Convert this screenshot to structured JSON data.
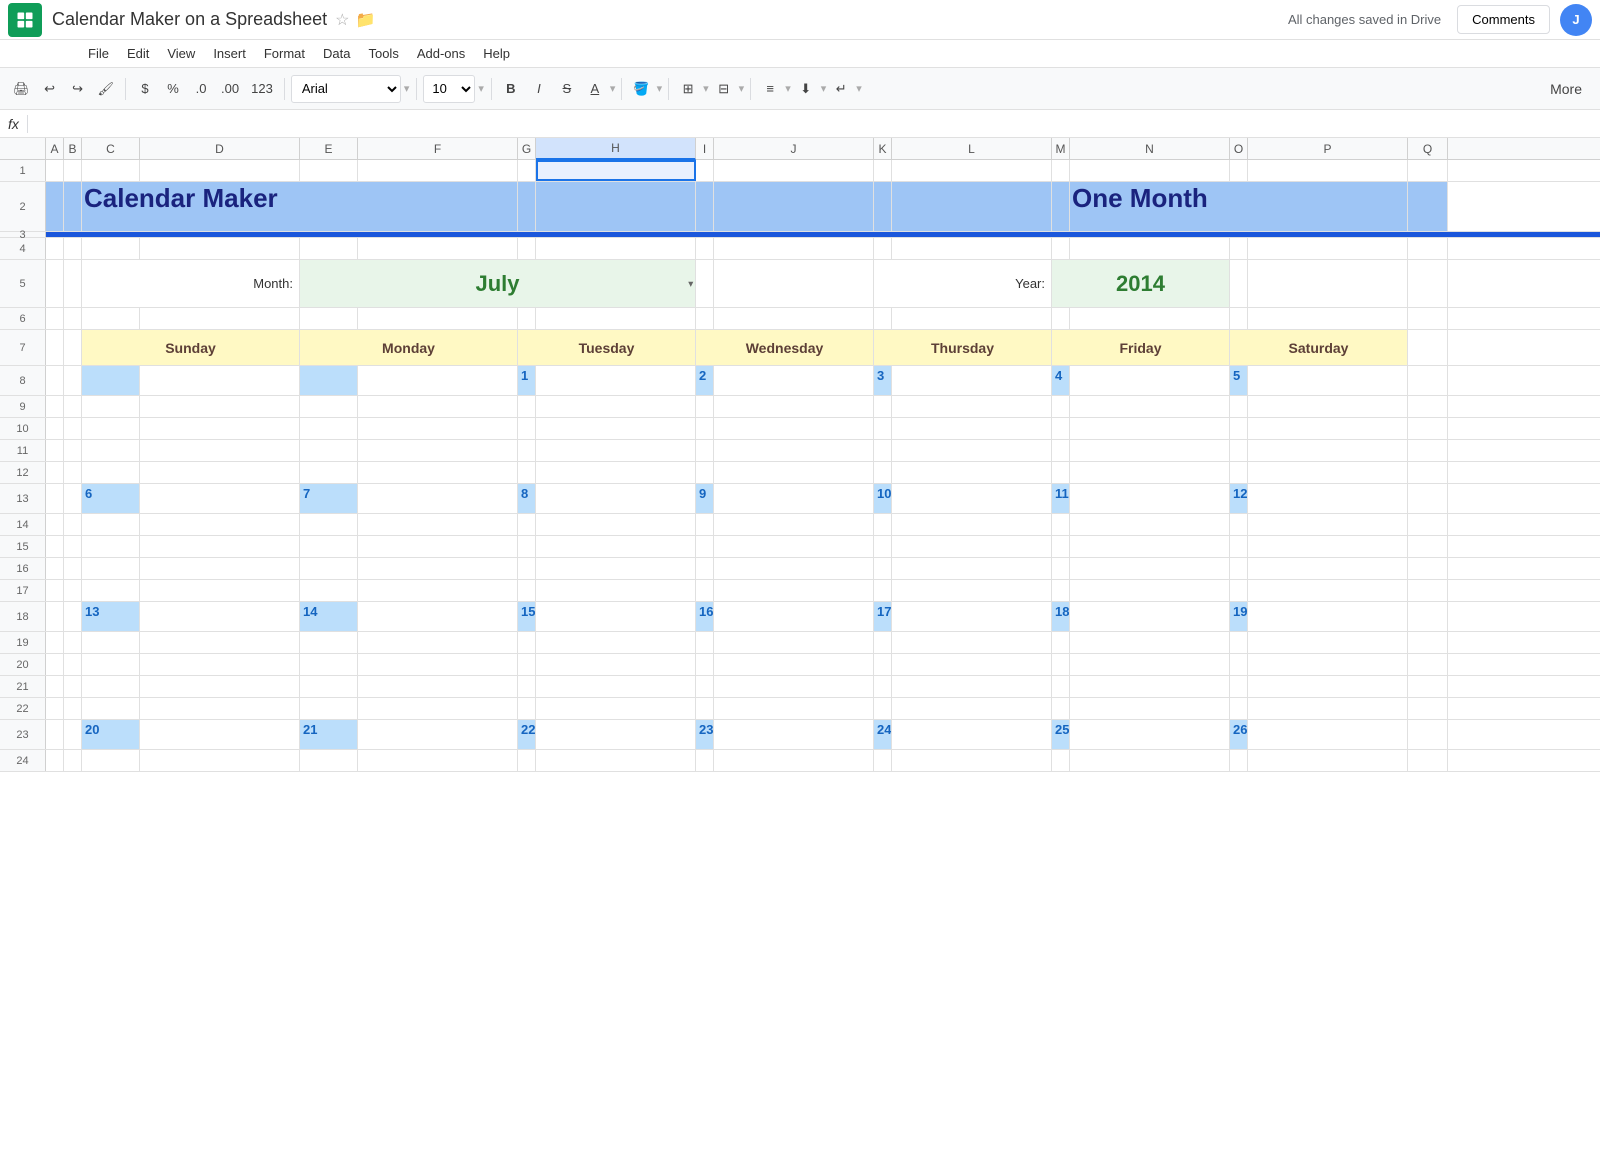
{
  "topbar": {
    "title": "Calendar Maker on a Spreadsheet",
    "save_status": "All changes saved in Drive",
    "comments_label": "Comments",
    "user_initials": "J"
  },
  "menu": {
    "items": [
      "File",
      "Edit",
      "View",
      "Insert",
      "Format",
      "Data",
      "Tools",
      "Add-ons",
      "Help"
    ]
  },
  "toolbar": {
    "font_name": "Arial",
    "font_size": "10",
    "more_label": "More"
  },
  "formula_bar": {
    "fx": "fx"
  },
  "columns": [
    "A",
    "B",
    "C",
    "D",
    "E",
    "F",
    "G",
    "H",
    "I",
    "J",
    "K",
    "L",
    "M",
    "N",
    "O",
    "P",
    "Q"
  ],
  "rows": [
    "1",
    "2",
    "3",
    "4",
    "5",
    "6",
    "7",
    "8",
    "9",
    "10",
    "11",
    "12",
    "13",
    "14",
    "15",
    "16",
    "17",
    "18",
    "19",
    "20",
    "21",
    "22",
    "23",
    "24"
  ],
  "calendar": {
    "title": "Calendar Maker",
    "subtitle": "One Month",
    "month_label": "Month:",
    "month_value": "July",
    "year_label": "Year:",
    "year_value": "2014",
    "days": [
      "Sunday",
      "Monday",
      "Tuesday",
      "Wednesday",
      "Thursday",
      "Friday",
      "Saturday"
    ],
    "week1_dates": [
      "",
      "",
      "1",
      "2",
      "3",
      "4",
      "5"
    ],
    "week2_dates": [
      "6",
      "7",
      "8",
      "9",
      "10",
      "11",
      "12"
    ],
    "week3_dates": [
      "13",
      "14",
      "15",
      "16",
      "17",
      "18",
      "19"
    ],
    "week4_dates": [
      "20",
      "21",
      "22",
      "23",
      "24",
      "25",
      "26"
    ]
  }
}
